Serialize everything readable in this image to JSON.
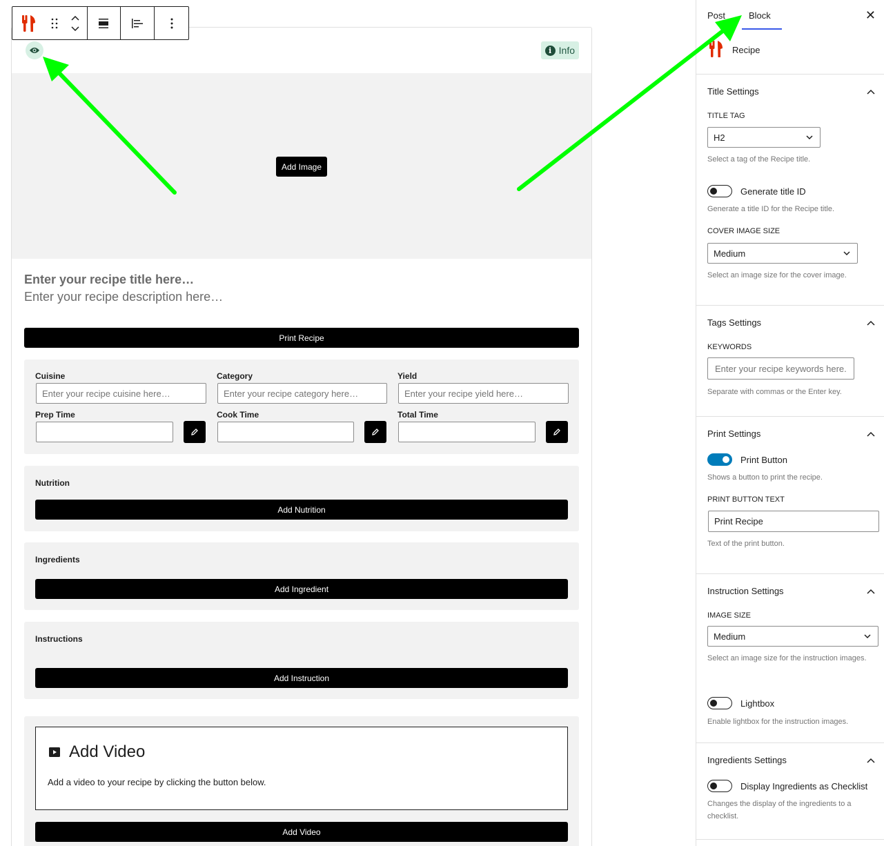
{
  "toolbar": {
    "block_icon": "fork-knife-icon",
    "items": [
      "drag-handle-icon",
      "move-up-down-icon",
      "align-icon",
      "justify-icon",
      "more-options-icon"
    ]
  },
  "block": {
    "info_label": "Info",
    "add_image_label": "Add Image",
    "title_placeholder": "Enter your recipe title here…",
    "description_placeholder": "Enter your recipe description here…",
    "print_button_label": "Print Recipe",
    "meta": {
      "cuisine_label": "Cuisine",
      "cuisine_placeholder": "Enter your recipe cuisine here…",
      "category_label": "Category",
      "category_placeholder": "Enter your recipe category here…",
      "yield_label": "Yield",
      "yield_placeholder": "Enter your recipe yield here…",
      "prep_label": "Prep Time",
      "cook_label": "Cook Time",
      "total_label": "Total Time"
    },
    "nutrition_title": "Nutrition",
    "add_nutrition_label": "Add Nutrition",
    "ingredients_title": "Ingredients",
    "add_ingredient_label": "Add Ingredient",
    "instructions_title": "Instructions",
    "add_instruction_label": "Add Instruction",
    "video_heading": "Add Video",
    "video_text": "Add a video to your recipe by clicking the button below.",
    "add_video_label": "Add Video"
  },
  "sidebar": {
    "tabs": [
      "Post",
      "Block"
    ],
    "active_tab": "Block",
    "block_name": "Recipe",
    "title_settings": {
      "heading": "Title Settings",
      "tag_label": "TITLE TAG",
      "tag_value": "H2",
      "tag_help": "Select a tag of the Recipe title.",
      "gen_id_label": "Generate title ID",
      "gen_id_on": false,
      "gen_id_help": "Generate a title ID for the Recipe title.",
      "cover_label": "COVER IMAGE SIZE",
      "cover_value": "Medium",
      "cover_help": "Select an image size for the cover image."
    },
    "tags_settings": {
      "heading": "Tags Settings",
      "keywords_label": "KEYWORDS",
      "keywords_placeholder": "Enter your recipe keywords here.",
      "keywords_help": "Separate with commas or the Enter key."
    },
    "print_settings": {
      "heading": "Print Settings",
      "print_toggle_label": "Print Button",
      "print_toggle_on": true,
      "print_toggle_help": "Shows a button to print the recipe.",
      "text_label": "PRINT BUTTON TEXT",
      "text_value": "Print Recipe",
      "text_help": "Text of the print button."
    },
    "instruction_settings": {
      "heading": "Instruction Settings",
      "size_label": "IMAGE SIZE",
      "size_value": "Medium",
      "size_help": "Select an image size for the instruction images.",
      "lightbox_label": "Lightbox",
      "lightbox_on": false,
      "lightbox_help": "Enable lightbox for the instruction images."
    },
    "ingredients_settings": {
      "heading": "Ingredients Settings",
      "checklist_label": "Display Ingredients as Checklist",
      "checklist_on": false,
      "checklist_help": "Changes the display of the ingredients to a checklist."
    }
  },
  "colors": {
    "accent_green": "#00ff00",
    "brand_red": "#e02c00",
    "toggle_on": "#007cba",
    "tab_underline": "#3858e9",
    "badge_bg": "#d7f0e4"
  }
}
